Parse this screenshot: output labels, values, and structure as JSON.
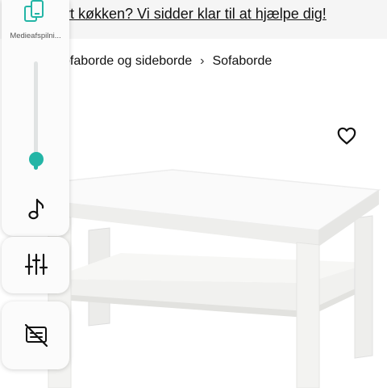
{
  "banner": {
    "link_text": "Nyt køkken? Vi sidder klar til at hjælpe dig!"
  },
  "breadcrumb": {
    "ellipsis": "...",
    "items": [
      "Sofaborde og sideborde",
      "Sofaborde"
    ],
    "separator": "›"
  },
  "product": {
    "favorite_icon": "heart-icon",
    "image": "white-coffee-table-with-shelf"
  },
  "media_panel": {
    "device_label": "Medieafspilni...",
    "device_icon": "phone-cast-icon",
    "volume_level": 0.1,
    "icons": [
      "music-note-icon",
      "equalizer-icon",
      "subtitles-off-icon"
    ],
    "accent_color": "#23b5a6"
  }
}
